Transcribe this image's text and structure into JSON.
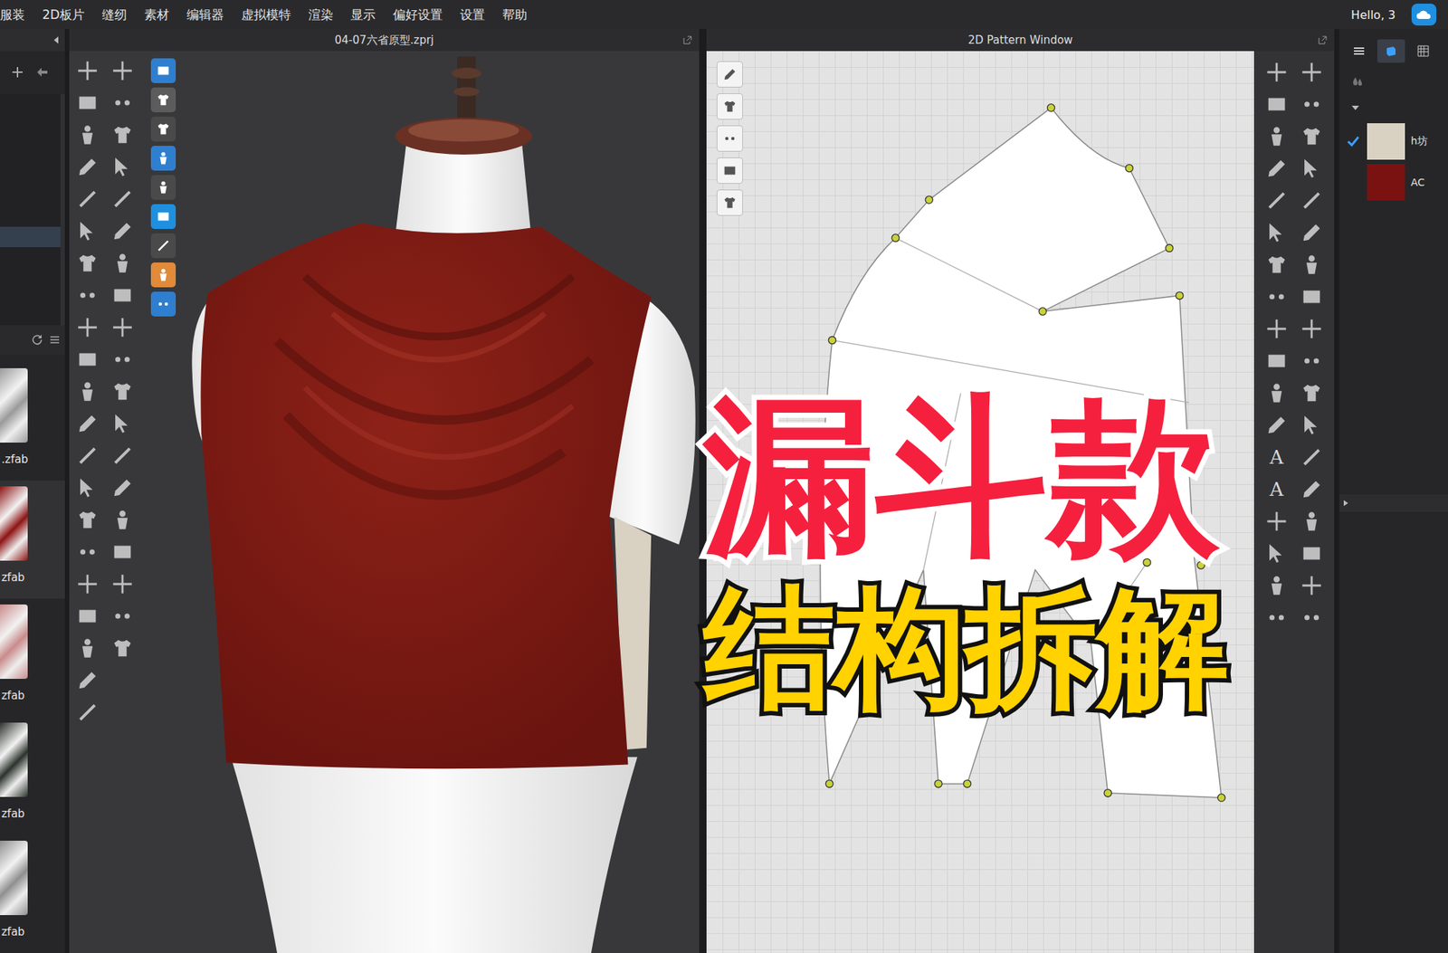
{
  "menu": [
    "服装",
    "2D板片",
    "缝纫",
    "素材",
    "编辑器",
    "虚拟模特",
    "渲染",
    "显示",
    "偏好设置",
    "设置",
    "帮助"
  ],
  "user": {
    "greeting": "Hello, 3"
  },
  "viewport": {
    "title": "04-07六省原型.zprj"
  },
  "pattern_window": {
    "title": "2D Pattern Window",
    "text_tools": [
      "A",
      "A"
    ]
  },
  "library": [
    {
      "label": ".zfab",
      "color": "#9a9a9a",
      "selected": false
    },
    {
      "label": "zfab",
      "color": "#8e1414",
      "selected": true
    },
    {
      "label": "zfab",
      "color": "#c98b8b",
      "selected": false
    },
    {
      "label": "zfab",
      "color": "#2c332c",
      "selected": false
    },
    {
      "label": "zfab",
      "color": "#8f8f8f",
      "selected": false
    }
  ],
  "panel_tabs": [
    {
      "selected": false
    },
    {
      "selected": true
    },
    {
      "selected": false
    }
  ],
  "fabrics": [
    {
      "name": "h坊",
      "color": "#d9d1c2",
      "checked": true
    },
    {
      "name": "AC",
      "color": "#7b1212",
      "checked": false
    }
  ],
  "overlay": [
    {
      "text": "漏斗款",
      "kind": "headline"
    },
    {
      "text": "结构拆解",
      "kind": "subheadline"
    }
  ]
}
